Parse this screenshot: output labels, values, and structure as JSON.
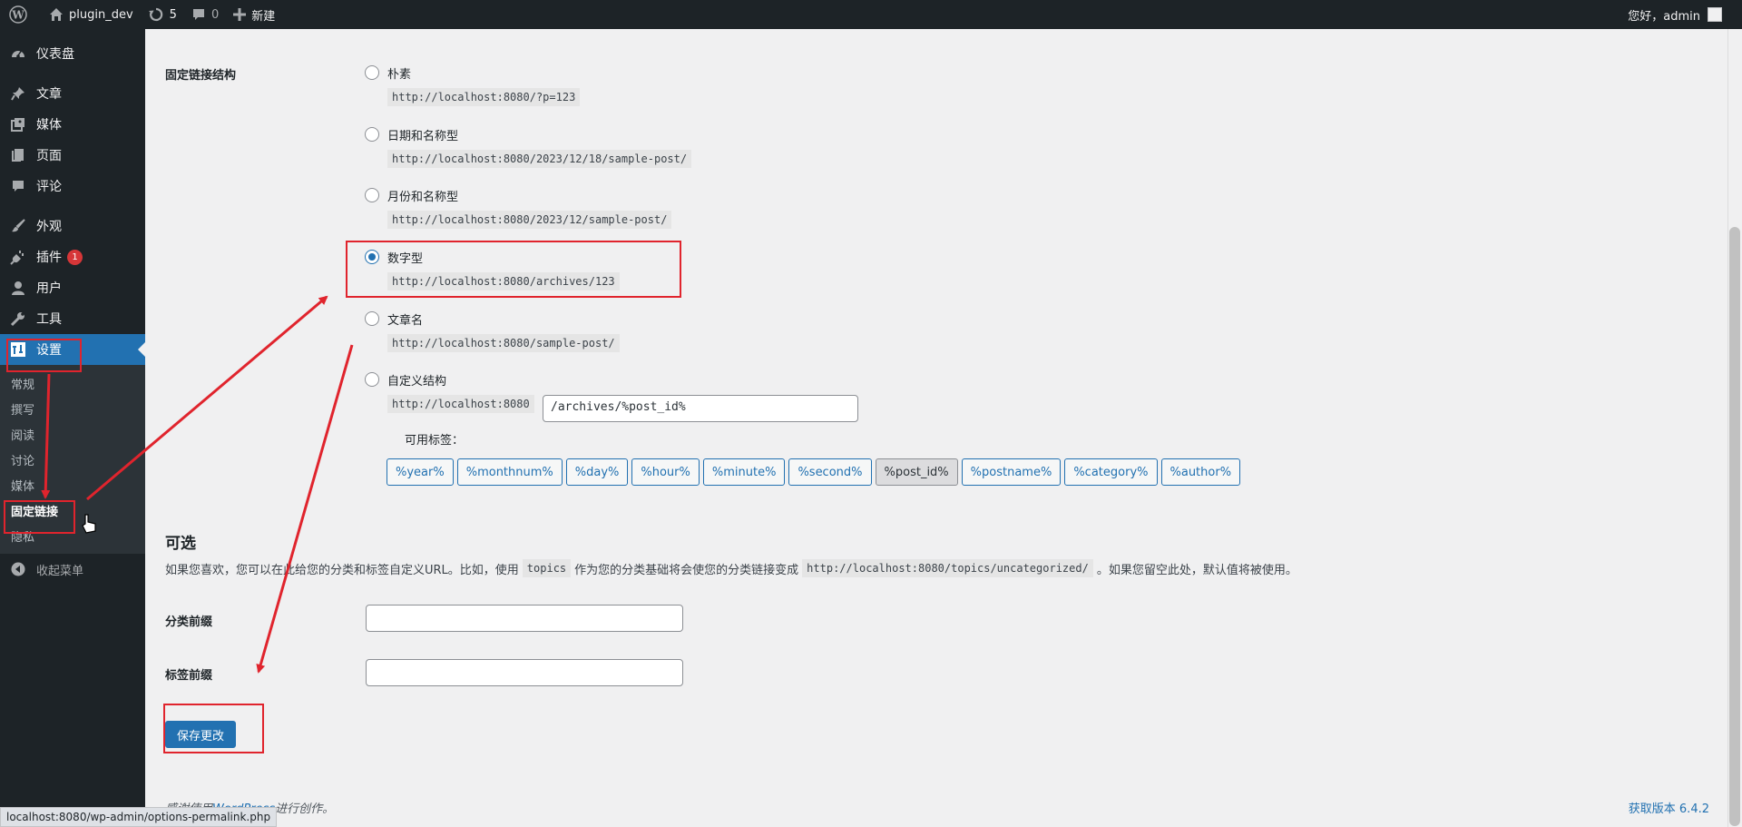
{
  "adminbar": {
    "site_name": "plugin_dev",
    "updates_count": "5",
    "comments_count": "0",
    "new_label": "新建",
    "greeting": "您好，admin"
  },
  "sidebar": {
    "items": [
      {
        "label": "仪表盘",
        "icon": "dashboard-icon"
      },
      {
        "label": "文章",
        "icon": "pin-icon"
      },
      {
        "label": "媒体",
        "icon": "media-icon"
      },
      {
        "label": "页面",
        "icon": "page-icon"
      },
      {
        "label": "评论",
        "icon": "comment-icon"
      },
      {
        "label": "外观",
        "icon": "brush-icon"
      },
      {
        "label": "插件",
        "icon": "plugin-icon",
        "badge": "1"
      },
      {
        "label": "用户",
        "icon": "user-icon"
      },
      {
        "label": "工具",
        "icon": "wrench-icon"
      },
      {
        "label": "设置",
        "icon": "settings-icon"
      }
    ],
    "submenu": [
      "常规",
      "撰写",
      "阅读",
      "讨论",
      "媒体",
      "固定链接",
      "隐私"
    ],
    "collapse_label": "收起菜单"
  },
  "permalink": {
    "label": "固定链接结构",
    "options": [
      {
        "label": "朴素",
        "example": "http://localhost:8080/?p=123",
        "checked": false
      },
      {
        "label": "日期和名称型",
        "example": "http://localhost:8080/2023/12/18/sample-post/",
        "checked": false
      },
      {
        "label": "月份和名称型",
        "example": "http://localhost:8080/2023/12/sample-post/",
        "checked": false
      },
      {
        "label": "数字型",
        "example": "http://localhost:8080/archives/123",
        "checked": true
      },
      {
        "label": "文章名",
        "example": "http://localhost:8080/sample-post/",
        "checked": false
      },
      {
        "label": "自定义结构",
        "example": "http://localhost:8080",
        "checked": false
      }
    ],
    "custom_value": "/archives/%post_id%",
    "available_tags_label": "可用标签：",
    "tags": [
      "%year%",
      "%monthnum%",
      "%day%",
      "%hour%",
      "%minute%",
      "%second%",
      "%post_id%",
      "%postname%",
      "%category%",
      "%author%"
    ],
    "active_tag": "%post_id%"
  },
  "optional": {
    "title": "可选",
    "desc_part1": "如果您喜欢，您可以在此给您的分类和标签自定义URL。比如，使用",
    "desc_code1": "topics",
    "desc_part2": "作为您的分类基础将会使您的分类链接变成",
    "desc_code2": "http://localhost:8080/topics/uncategorized/",
    "desc_part3": "。如果您留空此处，默认值将被使用。",
    "category_base_label": "分类前缀",
    "category_base_value": "",
    "tag_base_label": "标签前缀",
    "tag_base_value": ""
  },
  "save_label": "保存更改",
  "footer": {
    "thanks_prefix": "感谢使用",
    "thanks_link": "WordPress",
    "thanks_suffix": "进行创作。",
    "version": "获取版本 6.4.2"
  },
  "statusbar": "localhost:8080/wp-admin/options-permalink.php",
  "colors": {
    "annotation": "#e0242d",
    "accent": "#2271b1",
    "sidebar_bg": "#1d2327"
  }
}
